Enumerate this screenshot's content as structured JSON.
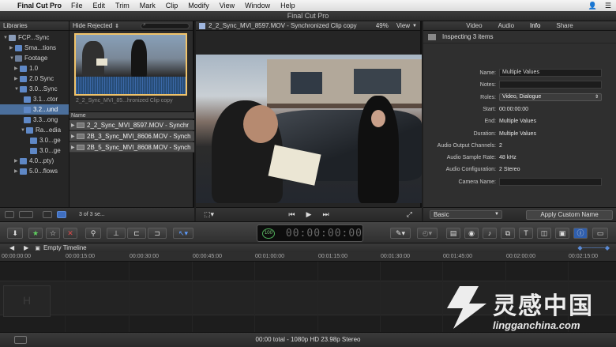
{
  "menubar": {
    "apple": "",
    "app_name": "Final Cut Pro",
    "items": [
      "File",
      "Edit",
      "Trim",
      "Mark",
      "Clip",
      "Modify",
      "View",
      "Window",
      "Help"
    ]
  },
  "window": {
    "title": "Final Cut Pro"
  },
  "libraries": {
    "header": "Libraries",
    "items": [
      {
        "label": "FCP...Sync"
      },
      {
        "label": "Sma...tions"
      },
      {
        "label": "Footage"
      },
      {
        "label": "1.0"
      },
      {
        "label": "2.0 Sync"
      },
      {
        "label": "3.0...Sync"
      },
      {
        "label": "3.1...ctor"
      },
      {
        "label": "3.2...und"
      },
      {
        "label": "3.3...ong"
      },
      {
        "label": "Ra...edia"
      },
      {
        "label": "3.0...ge"
      },
      {
        "label": "3.0...ge"
      },
      {
        "label": "4.0...pty)"
      },
      {
        "label": "5.0...flows"
      }
    ]
  },
  "browser": {
    "filter": "Hide Rejected",
    "thumb_caption": "2_2_Sync_MVI_85...hronized Clip copy",
    "column_name": "Name",
    "clips": [
      "2_2_Sync_MVI_8597.MOV - Synchr",
      "2B_3_Sync_MVI_8606.MOV - Synch",
      "2B_5_Sync_MVI_8608.MOV - Synch"
    ],
    "count": "3 of 3 se..."
  },
  "viewer": {
    "clip_title": "2_2_Sync_MVI_8597.MOV - Synchronized Clip copy",
    "zoom": "49%",
    "view_label": "View"
  },
  "inspector": {
    "tabs": [
      "Video",
      "Audio",
      "Info",
      "Share"
    ],
    "title": "Inspecting 3 items",
    "fields": [
      {
        "label": "Name:",
        "value": "Multiple Values"
      },
      {
        "label": "Notes:",
        "value": ""
      },
      {
        "label": "Roles:",
        "value": "Video, Dialogue"
      },
      {
        "label": "Start:",
        "value": "00:00:00:00"
      },
      {
        "label": "End:",
        "value": "Multiple Values"
      },
      {
        "label": "Duration:",
        "value": "Multiple Values"
      },
      {
        "label": "Audio Output Channels:",
        "value": "2"
      },
      {
        "label": "Audio Sample Rate:",
        "value": "48 kHz"
      },
      {
        "label": "Audio Configuration:",
        "value": "2 Stereo"
      },
      {
        "label": "Camera Name:",
        "value": ""
      }
    ],
    "metadata_view": "Basic",
    "apply_button": "Apply Custom Name"
  },
  "timecode": {
    "percent": "100",
    "time": "00:00:00:00"
  },
  "timeline": {
    "name": "Empty Timeline",
    "ruler": [
      "00:00:00:00",
      "00:00:15:00",
      "00:00:30:00",
      "00:00:45:00",
      "00:01:00:00",
      "00:01:15:00",
      "00:01:30:00",
      "00:01:45:00",
      "00:02:00:00",
      "00:02:15:00"
    ]
  },
  "status": {
    "text": "00:00 total - 1080p HD 23.98p Stereo"
  },
  "watermark": {
    "cn": "灵感中国",
    "en": "lingganchina.com"
  }
}
